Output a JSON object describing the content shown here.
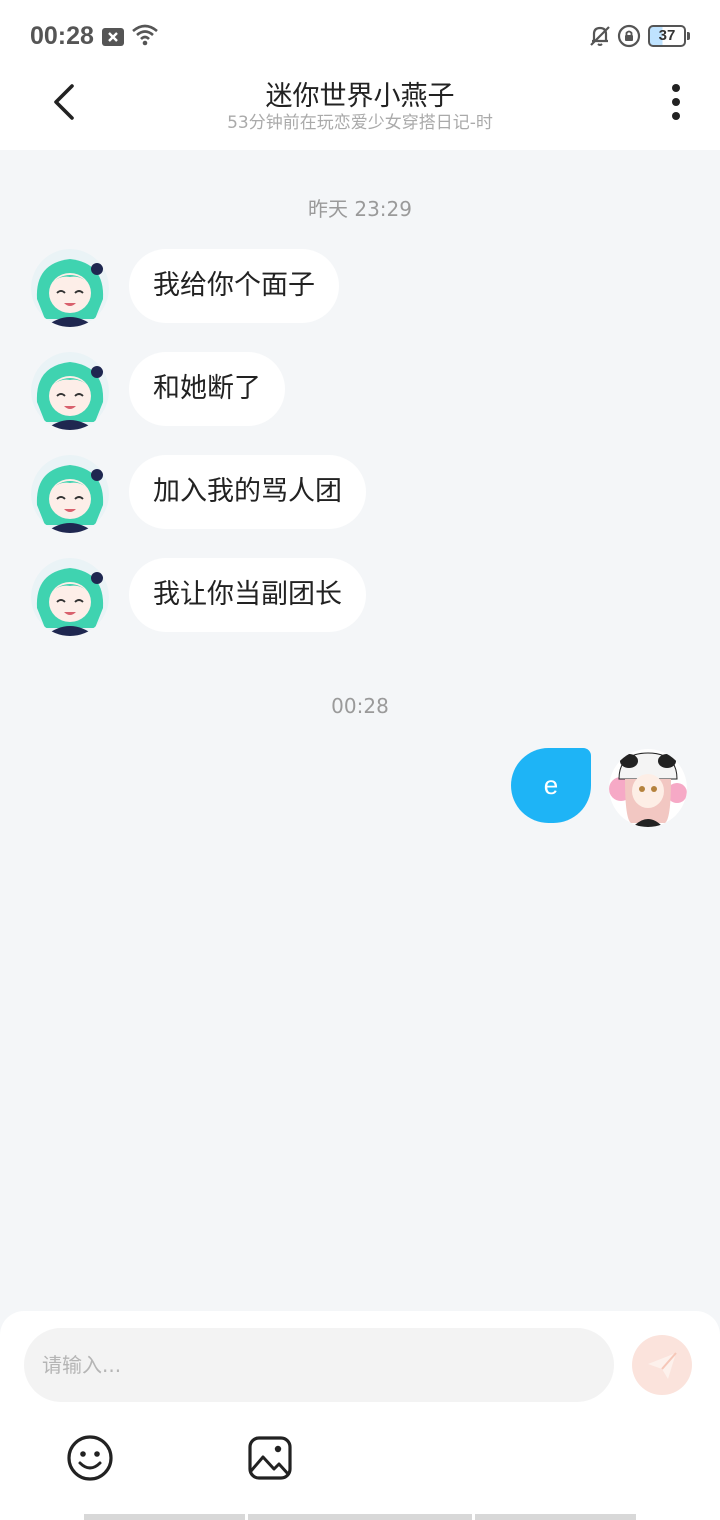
{
  "status_bar": {
    "time": "00:28",
    "battery": "37",
    "icons": [
      "notification-x-icon",
      "wifi-icon",
      "bell-off-icon",
      "rotation-lock-icon",
      "battery-icon"
    ]
  },
  "header": {
    "title": "迷你世界小燕子",
    "subtitle": "53分钟前在玩恋爱少女穿搭日记-时",
    "back_icon": "chevron-left-icon",
    "more_icon": "more-vertical-icon"
  },
  "messages": {
    "timestamp_1": "昨天 23:29",
    "incoming": [
      {
        "text": "我给你个面子"
      },
      {
        "text": "和她断了"
      },
      {
        "text": "加入我的骂人团"
      },
      {
        "text": "我让你当副团长"
      }
    ],
    "timestamp_2": "00:28",
    "outgoing": [
      {
        "text": "e"
      }
    ]
  },
  "input": {
    "placeholder": "请输入...",
    "value": "",
    "send_icon": "paper-plane-icon",
    "emoji_icon": "smiley-icon",
    "image_icon": "image-icon"
  },
  "colors": {
    "accent": "#1eb4f6",
    "background": "#f4f6f8",
    "send_button": "#fbe3dc"
  }
}
